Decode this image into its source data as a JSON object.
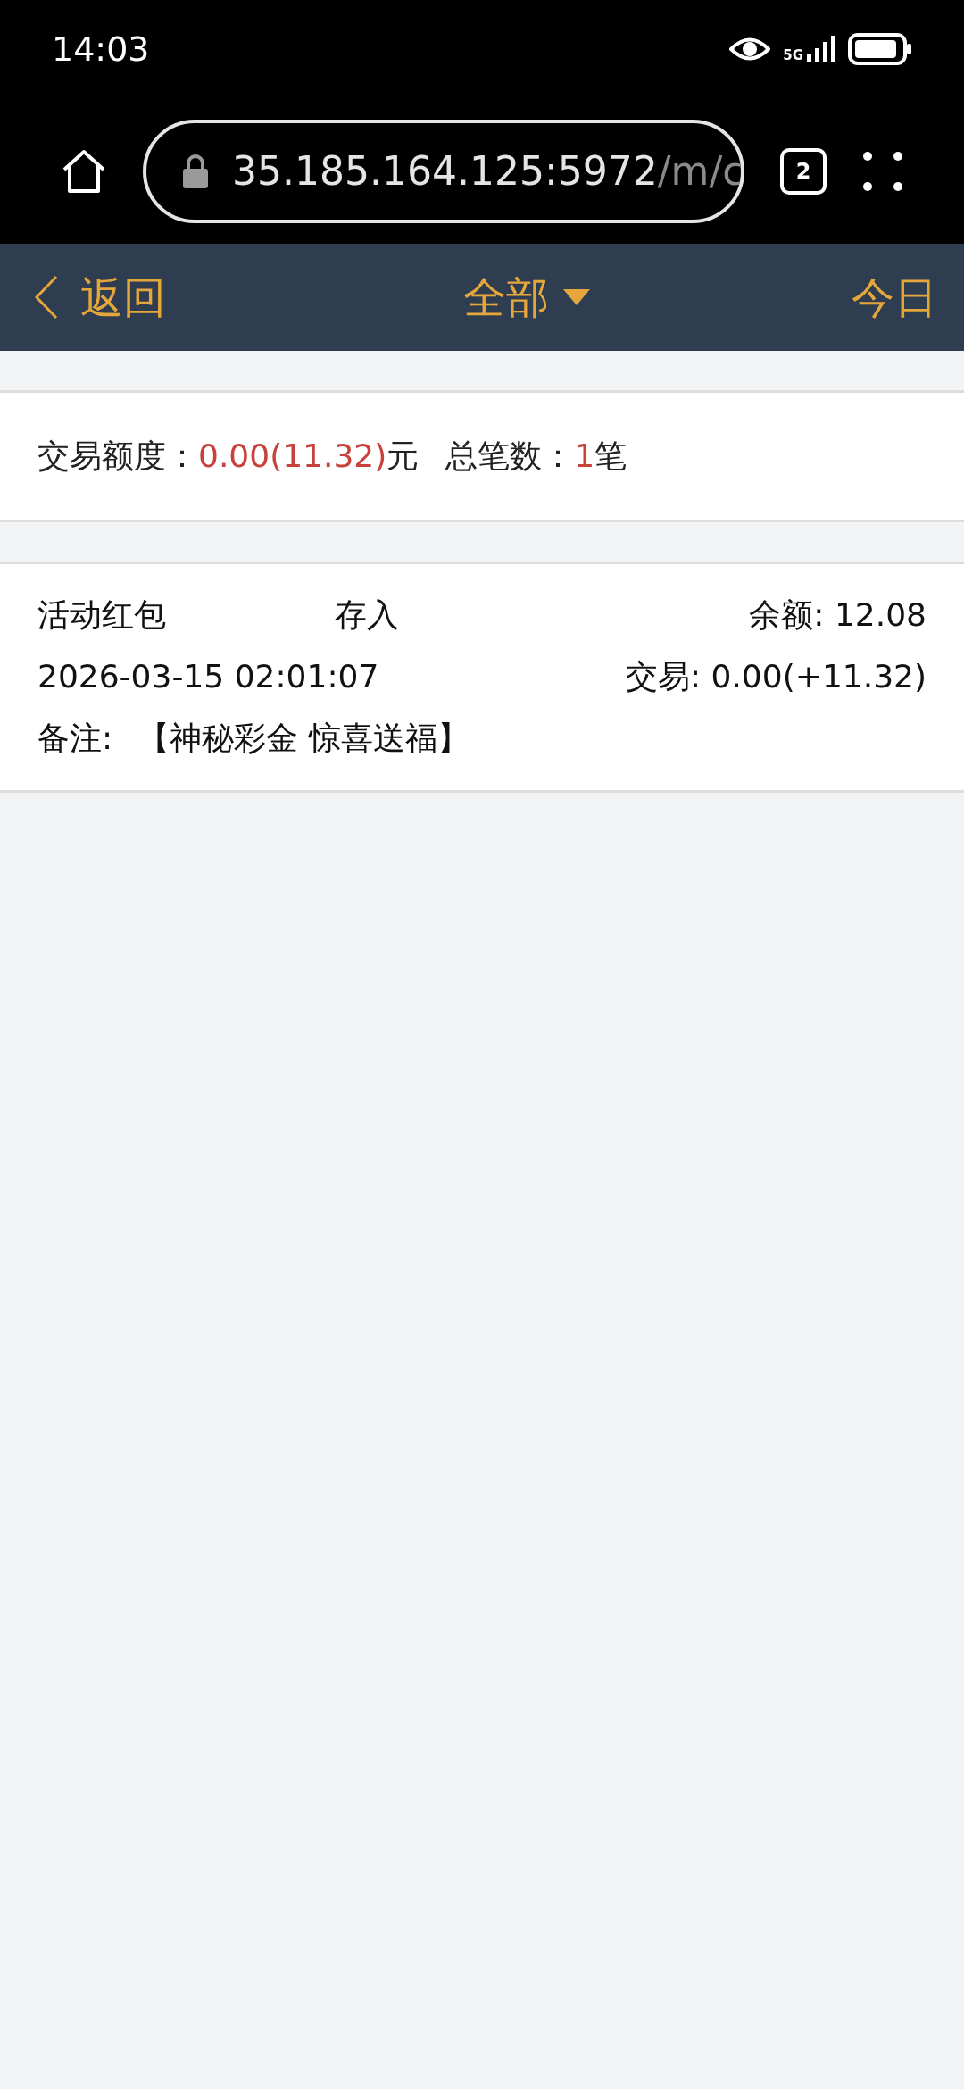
{
  "status_bar": {
    "time": "14:03",
    "network": "5G"
  },
  "browser": {
    "url_host": "35.185.164.125:5972",
    "url_path": "/m/c",
    "tab_count": "2"
  },
  "nav": {
    "back": "返回",
    "filter": "全部",
    "today": "今日"
  },
  "summary": [
    {
      "label": "交易额度：",
      "value": "0.00(11.32)",
      "unit": "元"
    },
    {
      "label": "总笔数：",
      "value": "1",
      "unit": "笔"
    }
  ],
  "records": [
    {
      "category": "活动红包",
      "type": "存入",
      "balance": "余额: 12.08",
      "time": "2026-03-15 02:01:07",
      "amount": "交易: 0.00(+11.32)",
      "note_label": "备注:",
      "note": "【神秘彩金 惊喜送福】"
    }
  ]
}
